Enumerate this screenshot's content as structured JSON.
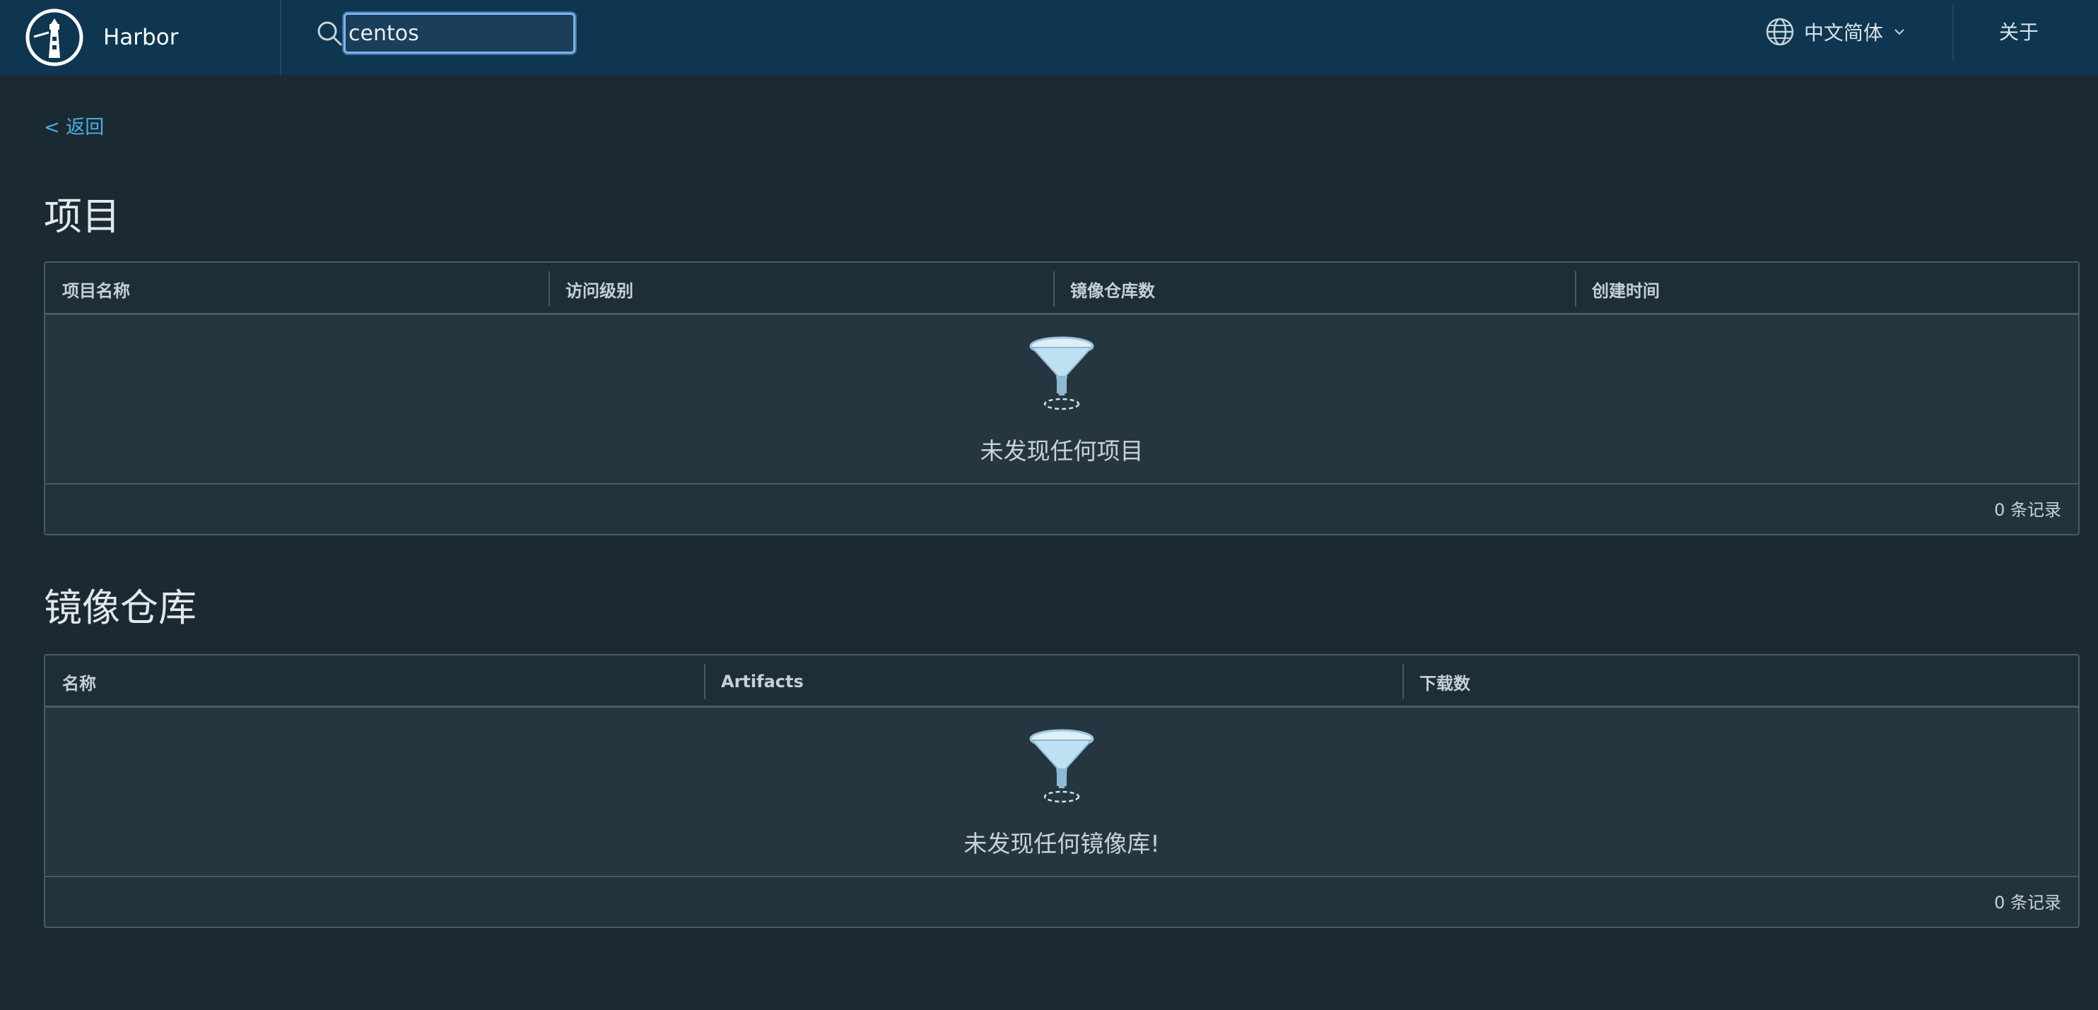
{
  "app": {
    "brand_name": "Harbor",
    "logo_icon": "harbor-lighthouse-logo"
  },
  "header": {
    "search_value": "centos",
    "language_label": "中文简体",
    "about_label": "关于"
  },
  "nav": {
    "back_label": "< 返回"
  },
  "projects": {
    "title": "项目",
    "columns": [
      "项目名称",
      "访问级别",
      "镜像仓库数",
      "创建时间"
    ],
    "empty_text": "未发现任何项目",
    "footer": "0 条记录"
  },
  "repositories": {
    "title": "镜像仓库",
    "columns": [
      "名称",
      "Artifacts",
      "下载数"
    ],
    "empty_text": "未发现任何镜像库!",
    "footer": "0 条记录"
  },
  "colors": {
    "header_bg": "#0f3650",
    "page_bg": "#1b2a32",
    "link": "#49aee6"
  }
}
